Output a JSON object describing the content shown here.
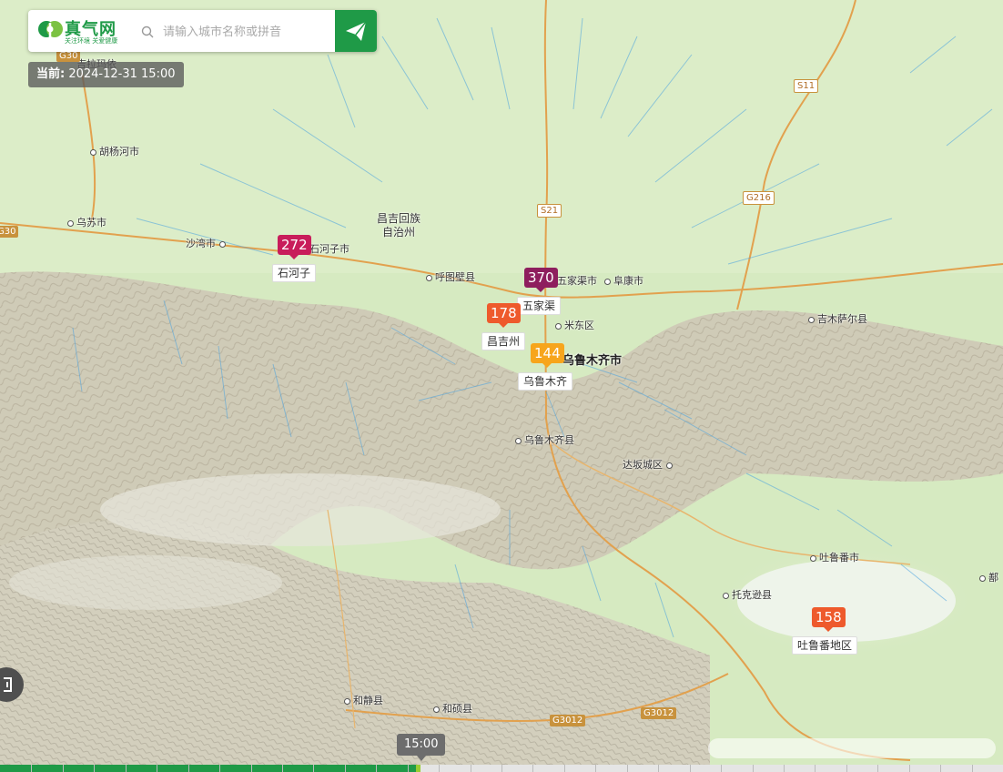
{
  "colors": {
    "brand_green": "#1f9a47",
    "plain": "#d9ebc4",
    "mountain": "#cfc9b4",
    "highway": "#e2a14e",
    "wind": "#4aa3e0"
  },
  "header": {
    "logo_main": "真气网",
    "logo_sub": "关注环境 关爱健康",
    "search_placeholder": "请输入城市名称或拼音",
    "send_icon": "paper-plane-icon",
    "search_icon": "search-icon"
  },
  "time_label": {
    "prefix": "当前:",
    "value": "2024-12-31 15:00"
  },
  "timeline": {
    "current_time": "15:00",
    "progress_fraction": 0.415
  },
  "map": {
    "places": [
      {
        "name": "吉拉玛依",
        "cls": ""
      },
      {
        "name": "胡杨河市",
        "cls": ""
      },
      {
        "name": "乌苏市",
        "cls": ""
      },
      {
        "name": "沙湾市",
        "cls": ""
      },
      {
        "name": "石河子市",
        "cls": ""
      },
      {
        "name": "呼图壁县",
        "cls": ""
      },
      {
        "name": "五家渠市",
        "cls": ""
      },
      {
        "name": "阜康市",
        "cls": ""
      },
      {
        "name": "米东区",
        "cls": ""
      },
      {
        "name": "吉木萨尔县",
        "cls": ""
      },
      {
        "name": "乌鲁木齐市",
        "cls": "big"
      },
      {
        "name": "乌鲁木齐县",
        "cls": ""
      },
      {
        "name": "达坂城区",
        "cls": ""
      },
      {
        "name": "吐鲁番市",
        "cls": ""
      },
      {
        "name": "托克逊县",
        "cls": ""
      },
      {
        "name": "和静县",
        "cls": ""
      },
      {
        "name": "和硕县",
        "cls": ""
      },
      {
        "name": "鄯",
        "cls": ""
      }
    ],
    "region_label": [
      "昌吉回族",
      "自治州"
    ],
    "highways": [
      "G30",
      "G30",
      "S21",
      "S11",
      "G216",
      "G3012",
      "G3012"
    ],
    "aqi_markers": [
      {
        "value": "272",
        "station": "石河子",
        "color": "#c81d5b"
      },
      {
        "value": "370",
        "station": "五家渠",
        "color": "#8e1e5e"
      },
      {
        "value": "178",
        "station": "昌吉州",
        "color": "#ee5a2c"
      },
      {
        "value": "144",
        "station": "乌鲁木齐",
        "color": "#f7a51c"
      },
      {
        "value": "158",
        "station": "吐鲁番地区",
        "color": "#ee5a2c"
      }
    ]
  }
}
